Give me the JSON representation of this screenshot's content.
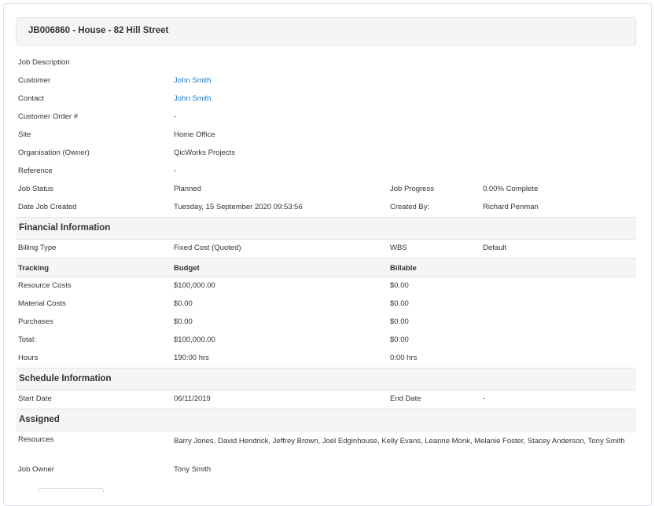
{
  "job": {
    "title": "JB006860 - House - 82 Hill Street"
  },
  "details": [
    {
      "label": "Job Description",
      "value": ""
    },
    {
      "label": "Customer",
      "value": "John Smith",
      "link": true
    },
    {
      "label": "Contact",
      "value": "John Smith",
      "link": true
    },
    {
      "label": "Customer Order #",
      "value": "-"
    },
    {
      "label": "Site",
      "value": "Home Office"
    },
    {
      "label": "Organisation (Owner)",
      "value": "QicWorks Projects"
    },
    {
      "label": "Reference",
      "value": "-"
    },
    {
      "label": "Job Status",
      "value": "Planned",
      "label2": "Job Progress",
      "value2": "0.00% Complete"
    },
    {
      "label": "Date Job Created",
      "value": "Tuesday, 15 September 2020 09:53:56",
      "label2": "Created By:",
      "value2": "Richard Penman"
    }
  ],
  "financial": {
    "title": "Financial Information",
    "billing": {
      "label": "Billing Type",
      "value": "Fixed Cost (Quoted)",
      "label2": "WBS",
      "value2": "Default"
    },
    "table_headers": [
      "Tracking",
      "Budget",
      "Billable"
    ],
    "rows": [
      {
        "label": "Resource Costs",
        "budget": "$100,000.00",
        "billable": "$0.00"
      },
      {
        "label": "Material Costs",
        "budget": "$0.00",
        "billable": "$0.00"
      },
      {
        "label": "Purchases",
        "budget": "$0.00",
        "billable": "$0.00"
      },
      {
        "label": "Total:",
        "budget": "$100,000.00",
        "billable": "$0.00"
      },
      {
        "label": "Hours",
        "budget": "190:00 hrs",
        "billable": "0:00 hrs"
      }
    ]
  },
  "schedule": {
    "title": "Schedule Information",
    "start_label": "Start Date",
    "start_value": "06/11/2019",
    "end_label": "End Date",
    "end_value": "-"
  },
  "assigned": {
    "title": "Assigned",
    "resources_label": "Resources",
    "resources_value": "Barry Jones, David Hendrick, Jeffrey Brown, Joel Edginhouse, Kelly Evans, Leanne Monk, Melanie Foster, Stacey Anderson, Tony Smith",
    "owner_label": "Job Owner",
    "owner_value": "Tony Smith"
  },
  "colors": {
    "link": "#1a7bc9",
    "section_bg": "#f5f5f5",
    "border": "#e3e3e3"
  }
}
